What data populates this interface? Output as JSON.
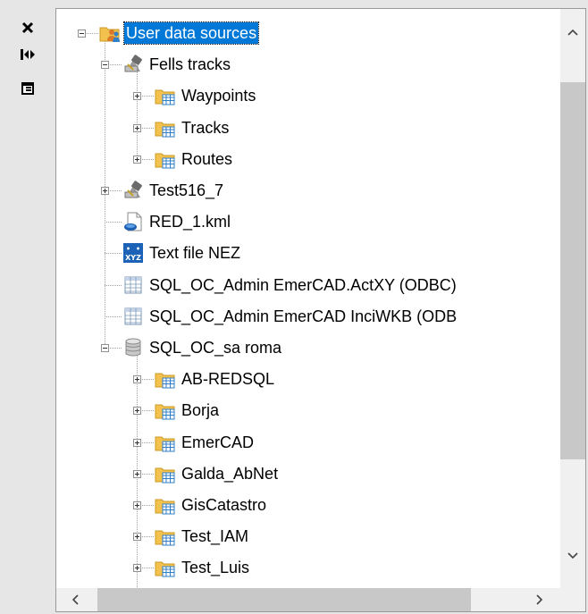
{
  "side_toolbar": {
    "close_icon": "close-icon",
    "autohide_icon": "autohide-icon",
    "properties_icon": "properties-icon"
  },
  "tree": {
    "root": {
      "label": "User data sources",
      "icon": "folder-users-icon",
      "expanded": true,
      "selected": true
    },
    "nodes": [
      {
        "label": "Fells tracks",
        "icon": "gps-device-icon",
        "expanded": true
      },
      {
        "label": "Waypoints",
        "icon": "folder-table-icon",
        "expanded": false
      },
      {
        "label": "Tracks",
        "icon": "folder-table-icon",
        "expanded": false
      },
      {
        "label": "Routes",
        "icon": "folder-table-icon",
        "expanded": false
      },
      {
        "label": "Test516_7",
        "icon": "gps-device-icon",
        "expanded": false
      },
      {
        "label": "RED_1.kml",
        "icon": "kml-file-icon"
      },
      {
        "label": "Text file NEZ",
        "icon": "xyz-text-file-icon"
      },
      {
        "label": "SQL_OC_Admin EmerCAD.ActXY (ODBC)",
        "icon": "table-icon"
      },
      {
        "label": "SQL_OC_Admin EmerCAD InciWKB (ODB",
        "icon": "table-icon"
      },
      {
        "label": "SQL_OC_sa roma",
        "icon": "database-icon",
        "expanded": true
      },
      {
        "label": "AB-REDSQL",
        "icon": "folder-table-icon",
        "expanded": false
      },
      {
        "label": "Borja",
        "icon": "folder-table-icon",
        "expanded": false
      },
      {
        "label": "EmerCAD",
        "icon": "folder-table-icon",
        "expanded": false
      },
      {
        "label": "Galda_AbNet",
        "icon": "folder-table-icon",
        "expanded": false
      },
      {
        "label": "GisCatastro",
        "icon": "folder-table-icon",
        "expanded": false
      },
      {
        "label": "Test_IAM",
        "icon": "folder-table-icon",
        "expanded": false
      },
      {
        "label": "Test_Luis",
        "icon": "folder-table-icon",
        "expanded": false
      }
    ]
  },
  "xyz_icon_text": "XYZ",
  "colors": {
    "selection": "#0078d7",
    "folder": "#f2c14e",
    "table_blue": "#2f7fc9",
    "scroll_thumb": "#c8c8c8"
  }
}
